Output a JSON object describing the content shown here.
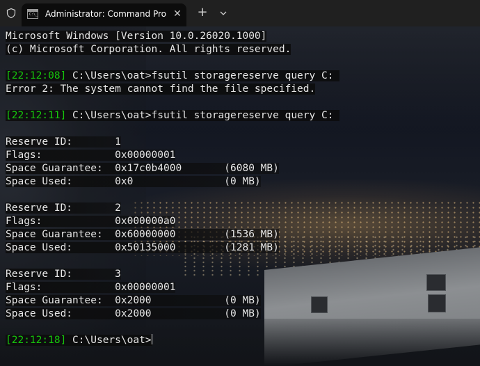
{
  "window": {
    "tab_title": "Administrator: Command Pro",
    "tab_icon_text": "C:\\_",
    "close_label": "✕",
    "new_tab_label": "+"
  },
  "terminal": {
    "header": [
      "Microsoft Windows [Version 10.0.26020.1000]",
      "(c) Microsoft Corporation. All rights reserved."
    ],
    "commands": [
      {
        "timestamp": "[22:12:08]",
        "prompt": " C:\\Users\\oat>fsutil storagereserve query C:",
        "output": "Error 2: The system cannot find the file specified."
      },
      {
        "timestamp": "[22:12:11]",
        "prompt": " C:\\Users\\oat>fsutil storagereserve query C:"
      }
    ],
    "reserves": [
      {
        "id_label": "Reserve ID:       ",
        "id_value": "1",
        "flags_label": "Flags:            ",
        "flags_value": "0x00000001",
        "guarantee_label": "Space Guarantee:  ",
        "guarantee_value": "0x17c0b4000       ",
        "guarantee_mb": "(6080 MB)",
        "used_label": "Space Used:       ",
        "used_value": "0x0               ",
        "used_mb": "(0 MB)"
      },
      {
        "id_label": "Reserve ID:       ",
        "id_value": "2",
        "flags_label": "Flags:            ",
        "flags_value": "0x000000a0",
        "guarantee_label": "Space Guarantee:  ",
        "guarantee_value": "0x60000000        ",
        "guarantee_mb": "(1536 MB)",
        "used_label": "Space Used:       ",
        "used_value": "0x50135000        ",
        "used_mb": "(1281 MB)"
      },
      {
        "id_label": "Reserve ID:       ",
        "id_value": "3",
        "flags_label": "Flags:            ",
        "flags_value": "0x00000001",
        "guarantee_label": "Space Guarantee:  ",
        "guarantee_value": "0x2000            ",
        "guarantee_mb": "(0 MB)",
        "used_label": "Space Used:       ",
        "used_value": "0x2000            ",
        "used_mb": "(0 MB)"
      }
    ],
    "final_prompt": {
      "timestamp": "[22:12:18]",
      "prompt": " C:\\Users\\oat>"
    }
  },
  "colors": {
    "titlebar": "#202020",
    "tab_bg": "#0c0c0c",
    "text": "#e6e6e6",
    "timestamp": "#16c60c"
  },
  "icons": [
    "shield-icon",
    "terminal-icon",
    "close-icon",
    "plus-icon",
    "chevron-down-icon"
  ]
}
